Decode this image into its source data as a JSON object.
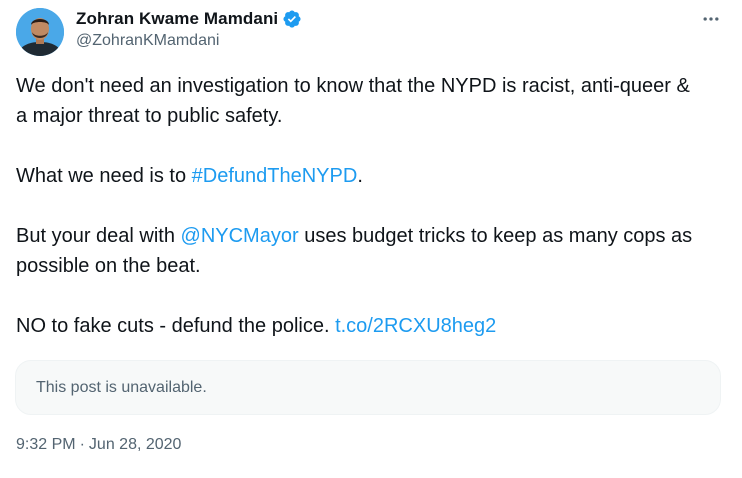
{
  "author": {
    "display_name": "Zohran Kwame Mamdani",
    "handle": "@ZohranKMamdani",
    "verified": true,
    "verified_color": "#1d9bf0"
  },
  "post": {
    "paragraphs": [
      {
        "segments": [
          {
            "text": "We don't need an investigation to know that the NYPD is racist, anti-queer & a major threat to public safety.",
            "link": false
          }
        ]
      },
      {
        "segments": [
          {
            "text": "What we need is to ",
            "link": false
          },
          {
            "text": "#DefundTheNYPD",
            "link": true
          },
          {
            "text": ".",
            "link": false
          }
        ]
      },
      {
        "segments": [
          {
            "text": "But your deal with ",
            "link": false
          },
          {
            "text": "@NYCMayor",
            "link": true
          },
          {
            "text": " uses budget tricks to keep as many cops as possible on the beat.",
            "link": false
          }
        ]
      },
      {
        "segments": [
          {
            "text": "NO to fake cuts - defund the police. ",
            "link": false
          },
          {
            "text": "t.co/2RCXU8heg2",
            "link": true
          }
        ]
      }
    ],
    "hashtag": "#DefundTheNYPD",
    "mention": "@NYCMayor",
    "url": "t.co/2RCXU8heg2",
    "quoted_unavailable": "This post is unavailable.",
    "time": "9:32 PM",
    "separator": "·",
    "date": "Jun 28, 2020"
  },
  "icons": {
    "more": "more-horizontal-icon",
    "verified": "verified-badge-icon",
    "avatar": "avatar"
  },
  "colors": {
    "link": "#1d9bf0",
    "secondary_text": "#536471",
    "primary_text": "#0f1419",
    "card_background": "#f7f9f9"
  }
}
